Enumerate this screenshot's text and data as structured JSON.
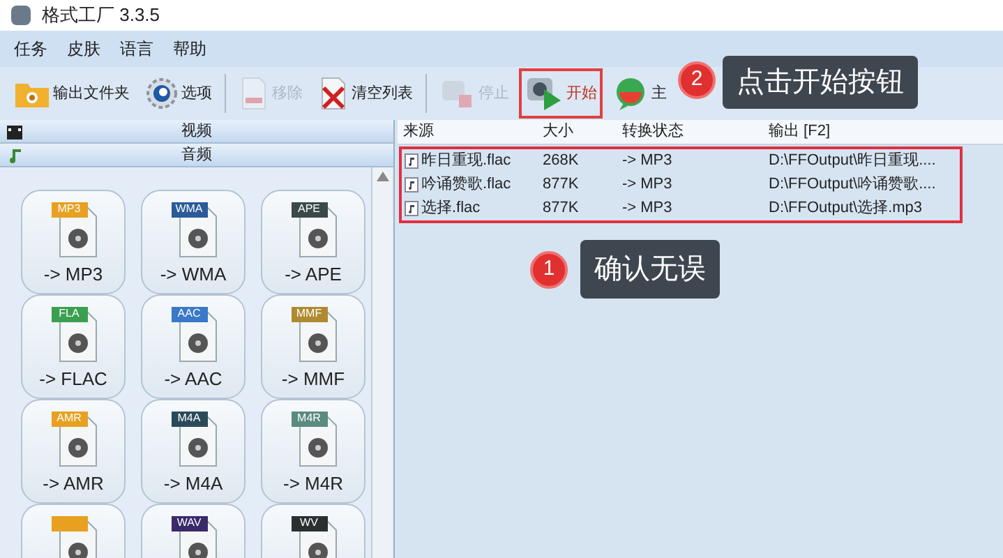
{
  "window": {
    "title": "格式工厂 3.3.5"
  },
  "menu": [
    "任务",
    "皮肤",
    "语言",
    "帮助"
  ],
  "toolbar": [
    {
      "kind": "folder",
      "label": "输出文件夹",
      "disabled": false,
      "highlighted": false
    },
    {
      "kind": "options",
      "label": "选项",
      "disabled": false,
      "highlighted": false
    },
    {
      "kind": "separator"
    },
    {
      "kind": "remove",
      "label": "移除",
      "disabled": true,
      "highlighted": false
    },
    {
      "kind": "clear",
      "label": "清空列表",
      "disabled": false,
      "highlighted": false
    },
    {
      "kind": "separator"
    },
    {
      "kind": "stop",
      "label": "停止",
      "disabled": true,
      "highlighted": false
    },
    {
      "kind": "start",
      "label": "开始",
      "disabled": false,
      "highlighted": true
    },
    {
      "kind": "home",
      "label": "主",
      "disabled": false,
      "highlighted": false
    }
  ],
  "sidebar": {
    "sections": [
      {
        "kind": "video",
        "label": "视频"
      },
      {
        "kind": "audio",
        "label": "音频"
      }
    ],
    "formats": [
      {
        "tag": "MP3",
        "color": "#e8a020",
        "label": "-> MP3"
      },
      {
        "tag": "WMA",
        "color": "#2a5a9a",
        "label": "-> WMA"
      },
      {
        "tag": "APE",
        "color": "#3a4a4a",
        "label": "-> APE"
      },
      {
        "tag": "FLA",
        "color": "#3aa050",
        "label": "-> FLAC"
      },
      {
        "tag": "AAC",
        "color": "#3a78c8",
        "label": "-> AAC"
      },
      {
        "tag": "MMF",
        "color": "#b08a30",
        "label": "-> MMF"
      },
      {
        "tag": "AMR",
        "color": "#e8a020",
        "label": "-> AMR"
      },
      {
        "tag": "M4A",
        "color": "#2a4a5a",
        "label": "-> M4A"
      },
      {
        "tag": "M4R",
        "color": "#5a8a80",
        "label": "-> M4R"
      },
      {
        "color": "#e8a020"
      },
      {
        "tag": "WAV",
        "color": "#3a2a6a"
      },
      {
        "tag": "WV",
        "color": "#2a3030"
      }
    ]
  },
  "table": {
    "columns": [
      "来源",
      "大小",
      "转换状态",
      "输出 [F2]"
    ],
    "rows": [
      [
        "昨日重现.flac",
        "268K",
        "-> MP3",
        "D:\\FFOutput\\昨日重现...."
      ],
      [
        "吟诵赞歌.flac",
        "877K",
        "-> MP3",
        "D:\\FFOutput\\吟诵赞歌...."
      ],
      [
        "选择.flac",
        "877K",
        "-> MP3",
        "D:\\FFOutput\\选择.mp3"
      ]
    ]
  },
  "callouts": [
    {
      "number": "2",
      "text": "点击开始按钮"
    },
    {
      "number": "1",
      "text": "确认无误"
    }
  ]
}
